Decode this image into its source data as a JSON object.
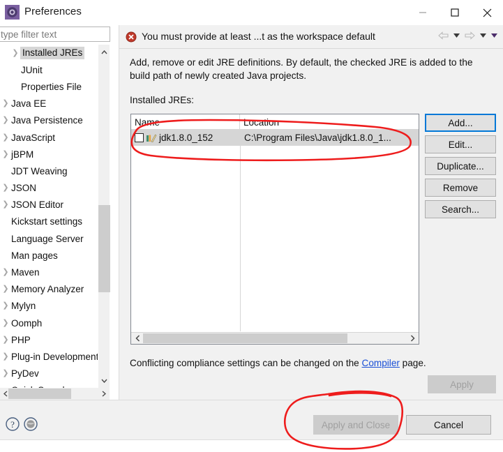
{
  "window": {
    "title": "Preferences",
    "icon": "preferences-gear-icon",
    "controls": {
      "minimize": "minimize-icon",
      "maximize": "maximize-icon",
      "close": "close-icon"
    }
  },
  "sidebar": {
    "filter": {
      "placeholder": "type filter text",
      "value": ""
    },
    "items": [
      {
        "label": "Installed JREs",
        "expandable": true,
        "indent": true,
        "selected": true
      },
      {
        "label": "JUnit",
        "expandable": false,
        "indent": true,
        "selected": false
      },
      {
        "label": "Properties File",
        "expandable": false,
        "indent": true,
        "selected": false
      },
      {
        "label": "Java EE",
        "expandable": true,
        "indent": false,
        "selected": false
      },
      {
        "label": "Java Persistence",
        "expandable": true,
        "indent": false,
        "selected": false
      },
      {
        "label": "JavaScript",
        "expandable": true,
        "indent": false,
        "selected": false
      },
      {
        "label": "jBPM",
        "expandable": true,
        "indent": false,
        "selected": false
      },
      {
        "label": "JDT Weaving",
        "expandable": false,
        "indent": false,
        "selected": false
      },
      {
        "label": "JSON",
        "expandable": true,
        "indent": false,
        "selected": false
      },
      {
        "label": "JSON Editor",
        "expandable": true,
        "indent": false,
        "selected": false
      },
      {
        "label": "Kickstart settings",
        "expandable": false,
        "indent": false,
        "selected": false
      },
      {
        "label": "Language Server",
        "expandable": false,
        "indent": false,
        "selected": false
      },
      {
        "label": "Man pages",
        "expandable": false,
        "indent": false,
        "selected": false
      },
      {
        "label": "Maven",
        "expandable": true,
        "indent": false,
        "selected": false
      },
      {
        "label": "Memory Analyzer",
        "expandable": true,
        "indent": false,
        "selected": false
      },
      {
        "label": "Mylyn",
        "expandable": true,
        "indent": false,
        "selected": false
      },
      {
        "label": "Oomph",
        "expandable": true,
        "indent": false,
        "selected": false
      },
      {
        "label": "PHP",
        "expandable": true,
        "indent": false,
        "selected": false
      },
      {
        "label": "Plug-in Development",
        "expandable": true,
        "indent": false,
        "selected": false
      },
      {
        "label": "PyDev",
        "expandable": true,
        "indent": false,
        "selected": false
      },
      {
        "label": "Quick Search",
        "expandable": false,
        "indent": false,
        "selected": false
      }
    ]
  },
  "message": {
    "icon": "error-icon",
    "text": "You must provide at least ...t as the workspace default",
    "nav": {
      "back": "back-arrow-icon",
      "back_menu": "chevron-down-icon",
      "forward": "forward-arrow-icon",
      "forward_menu": "chevron-down-icon",
      "view_menu": "chevron-down-icon"
    }
  },
  "page": {
    "description": "Add, remove or edit JRE definitions. By default, the checked JRE is added to the build path of newly created Java projects.",
    "section_label": "Installed JREs:",
    "note_prefix": "Conflicting compliance settings can be changed on the ",
    "note_link": "Compiler",
    "note_suffix": " page."
  },
  "table": {
    "columns": [
      "Name",
      "Location"
    ],
    "rows": [
      {
        "checked": false,
        "icon": "jre-library-icon",
        "name": "jdk1.8.0_152",
        "location": "C:\\Program Files\\Java\\jdk1.8.0_1...",
        "selected": true
      }
    ],
    "scrollbar": {
      "left_arrow": "chevron-left-icon",
      "right_arrow": "chevron-right-icon"
    }
  },
  "buttons": {
    "add": "Add...",
    "edit": "Edit...",
    "duplicate": "Duplicate...",
    "remove": "Remove",
    "search": "Search...",
    "apply": "Apply",
    "apply_and_close": "Apply and Close",
    "cancel": "Cancel"
  },
  "bottom": {
    "help_icon": "help-icon",
    "globe_icon": "globe-icon"
  },
  "annotations": {
    "ellipse_table_row": "red-ellipse-around-jre-row",
    "ellipse_apply_close": "red-ellipse-around-apply-and-close"
  },
  "colors": {
    "accent": "#0078d7",
    "error": "#cc3333",
    "link": "#1a4fd6",
    "annotation": "#ee1c1c",
    "selection": "#d6d6d6"
  }
}
